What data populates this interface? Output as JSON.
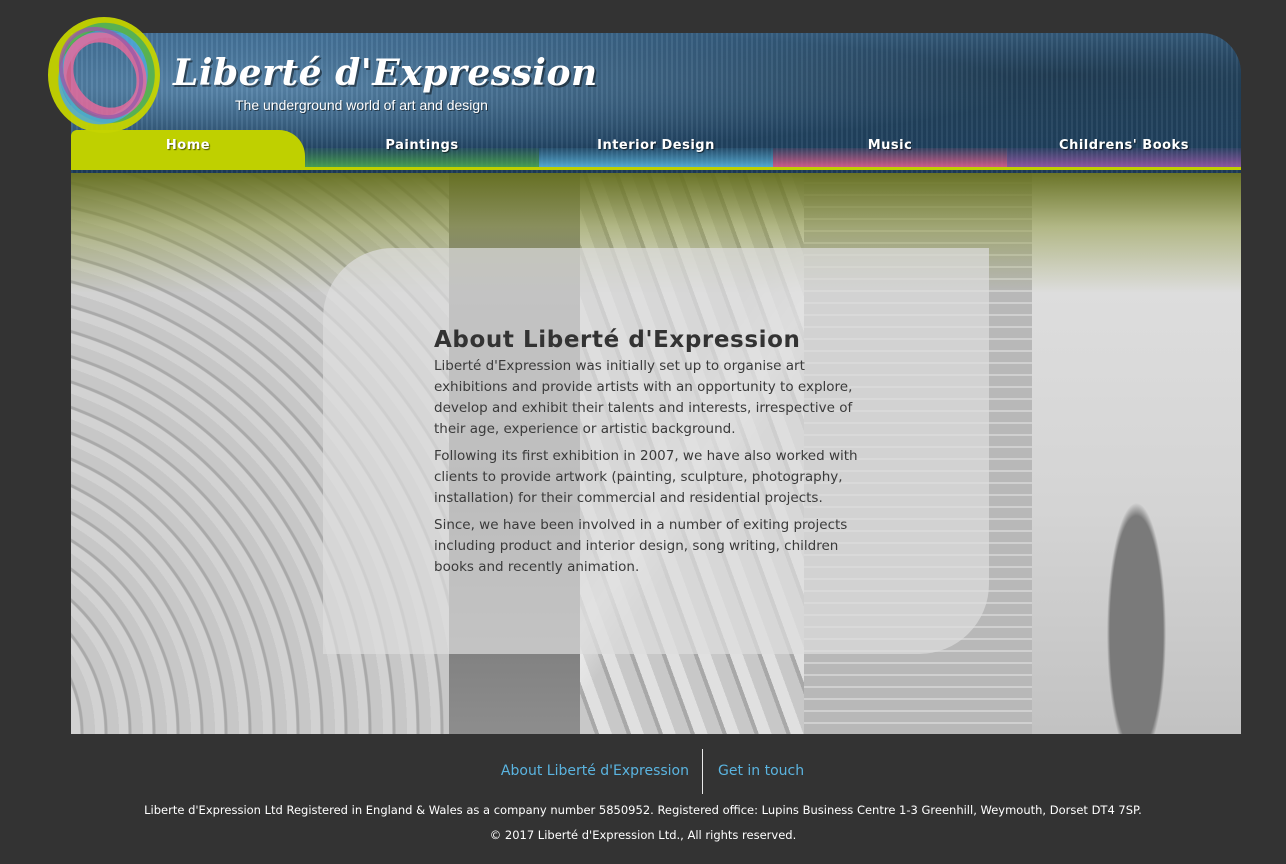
{
  "brand": {
    "title": "Liberté d'Expression",
    "tagline": "The underground world of art and design",
    "logo_icon": "paint-ring-logo-icon"
  },
  "nav": {
    "items": [
      {
        "label": "Home",
        "color": "#bfd000",
        "active": true
      },
      {
        "label": "Paintings",
        "color": "#4daa52",
        "active": false
      },
      {
        "label": "Interior  Design",
        "color": "#5bb6df",
        "active": false
      },
      {
        "label": "Music",
        "color": "#e2608f",
        "active": false
      },
      {
        "label": "Childrens'  Books",
        "color": "#9a5aa8",
        "active": false
      }
    ]
  },
  "about": {
    "title": "About  Liberté  d'Expression",
    "paragraphs": [
      "Liberté d'Expression was initially set up to organise art exhibitions and provide artists with an opportunity to explore, develop and exhibit their talents and interests, irrespective of their age, experience or artistic background.",
      "Following its first exhibition in 2007, we have also worked with clients to provide artwork (painting, sculpture, photography, installation) for their commercial and residential projects.",
      "Since, we have been involved in a number of exiting projects including product and interior design, song writing, children books and recently animation."
    ]
  },
  "footer": {
    "links": {
      "about": "About Liberté d'Expression",
      "contact": "Get in touch"
    },
    "registration": "Liberte d'Expression Ltd Registered in England & Wales as a company number 5850952. Registered office: Lupins Business Centre 1-3 Greenhill, Weymouth, Dorset DT4 7SP.",
    "copyright": "© 2017 Liberté d'Expression Ltd., All rights reserved.",
    "link_color": "#5ab4e0"
  }
}
